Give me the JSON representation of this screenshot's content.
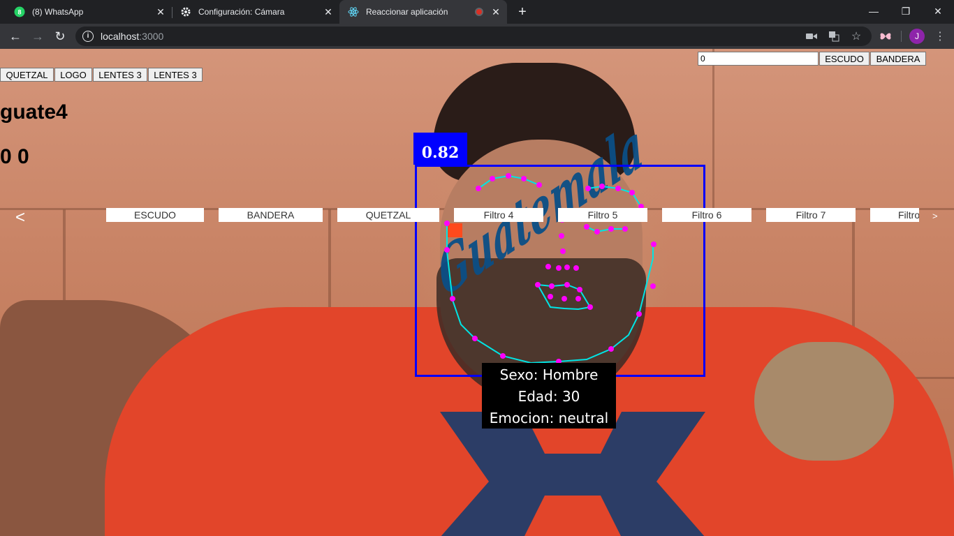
{
  "browser": {
    "tabs": [
      {
        "title": "(8) WhatsApp",
        "icon": "whatsapp-icon",
        "active": false
      },
      {
        "title": "Configuración: Cámara",
        "icon": "gear-icon",
        "active": false
      },
      {
        "title": "Reaccionar aplicación",
        "icon": "react-icon",
        "active": true
      }
    ],
    "new_tab": "+",
    "url_host": "localhost",
    "url_port": ":3000",
    "profile_initial": "J"
  },
  "controls": {
    "top_buttons": [
      "QUETZAL",
      "LOGO",
      "LENTES 3",
      "LENTES 3"
    ],
    "number_input_value": "0",
    "right_buttons": [
      "ESCUDO",
      "BANDERA"
    ]
  },
  "status": {
    "filter_name": "guate4",
    "coordinates": "0 0"
  },
  "carousel": {
    "prev": "<",
    "next": ">",
    "items": [
      "ESCUDO",
      "BANDERA",
      "QUETZAL",
      "Filtro 4",
      "Filtro 5",
      "Filtro 6",
      "Filtro 7",
      "Filtro"
    ]
  },
  "detection": {
    "score": "0.82",
    "sex_line": "Sexo: Hombre",
    "age_line": "Edad: 30",
    "emotion_line": "Emocion: neutral",
    "overlay_text": "Guatemala"
  },
  "colors": {
    "box": "#0000ff",
    "landmark_dot": "#ff00ff",
    "landmark_line": "#00e5e5"
  }
}
